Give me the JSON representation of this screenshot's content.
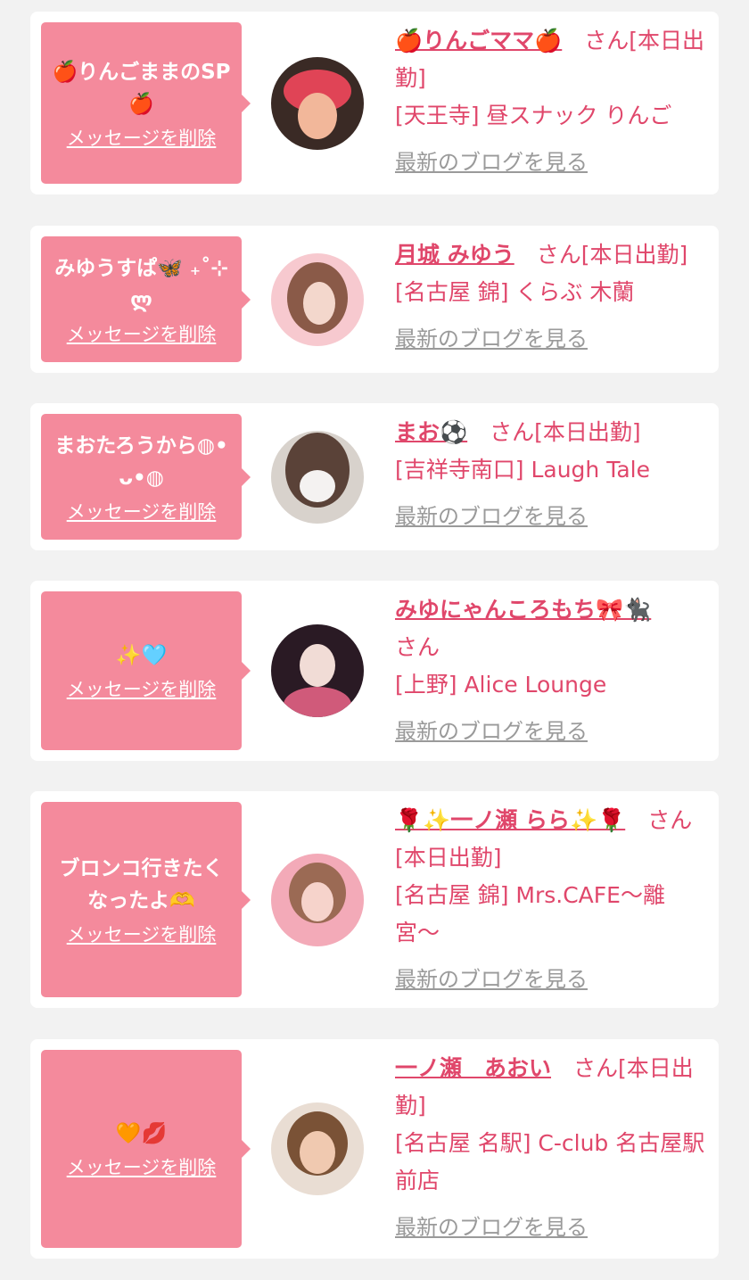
{
  "items": [
    {
      "message": "🍎りんごままのSP🍎",
      "delete_label": "メッセージを削除",
      "name": "🍎りんごママ🍎",
      "status": "　さん[本日出勤]",
      "shop": "[天王寺] 昼スナック りんご",
      "blog_label": "最新のブログを見る",
      "avatar_colors": [
        "#3a2a25",
        "#e04456",
        "#f2b79a"
      ]
    },
    {
      "message": "みゆうすぱ🦋 ₊˚⊹ლ",
      "delete_label": "メッセージを削除",
      "name": "月城 みゆう",
      "status": "　さん[本日出勤]",
      "shop": "[名古屋 錦] くらぶ 木蘭",
      "blog_label": "最新のブログを見る",
      "avatar_colors": [
        "#f7c9cf",
        "#8a5a48",
        "#f3d7cc"
      ]
    },
    {
      "message": "まおたろうから◍•ᴗ•◍",
      "delete_label": "メッセージを削除",
      "name": "まお⚽️",
      "status": "　さん[本日出勤]",
      "shop": "[吉祥寺南口] Laugh Tale",
      "blog_label": "最新のブログを見る",
      "avatar_colors": [
        "#d8d2cc",
        "#5a4238",
        "#f4f2f1"
      ]
    },
    {
      "message": "✨🩵",
      "delete_label": "メッセージを削除",
      "name": "みゆにゃんころもち🎀🐈‍⬛",
      "status": "さん",
      "shop": "[上野] Alice Lounge",
      "blog_label": "最新のブログを見る",
      "avatar_colors": [
        "#2a1a24",
        "#f1dcd6",
        "#d05a7a"
      ]
    },
    {
      "message": "ブロンコ行きたくなったよ🫶",
      "delete_label": "メッセージを削除",
      "name": "🌹✨一ノ瀬 らら✨🌹",
      "status": "　さん[本日出勤]",
      "shop": "[名古屋 錦] Mrs.CAFE〜離宮〜",
      "blog_label": "最新のブログを見る",
      "avatar_colors": [
        "#f3aab8",
        "#9b6a54",
        "#f6d3cb"
      ]
    },
    {
      "message": "🧡💋",
      "delete_label": "メッセージを削除",
      "name": "一ノ瀬　あおい",
      "status": "　さん[本日出勤]",
      "shop": "[名古屋 名駅] C-club 名古屋駅前店",
      "blog_label": "最新のブログを見る",
      "avatar_colors": [
        "#e9ddd3",
        "#7a5236",
        "#f0c9b0"
      ]
    }
  ]
}
